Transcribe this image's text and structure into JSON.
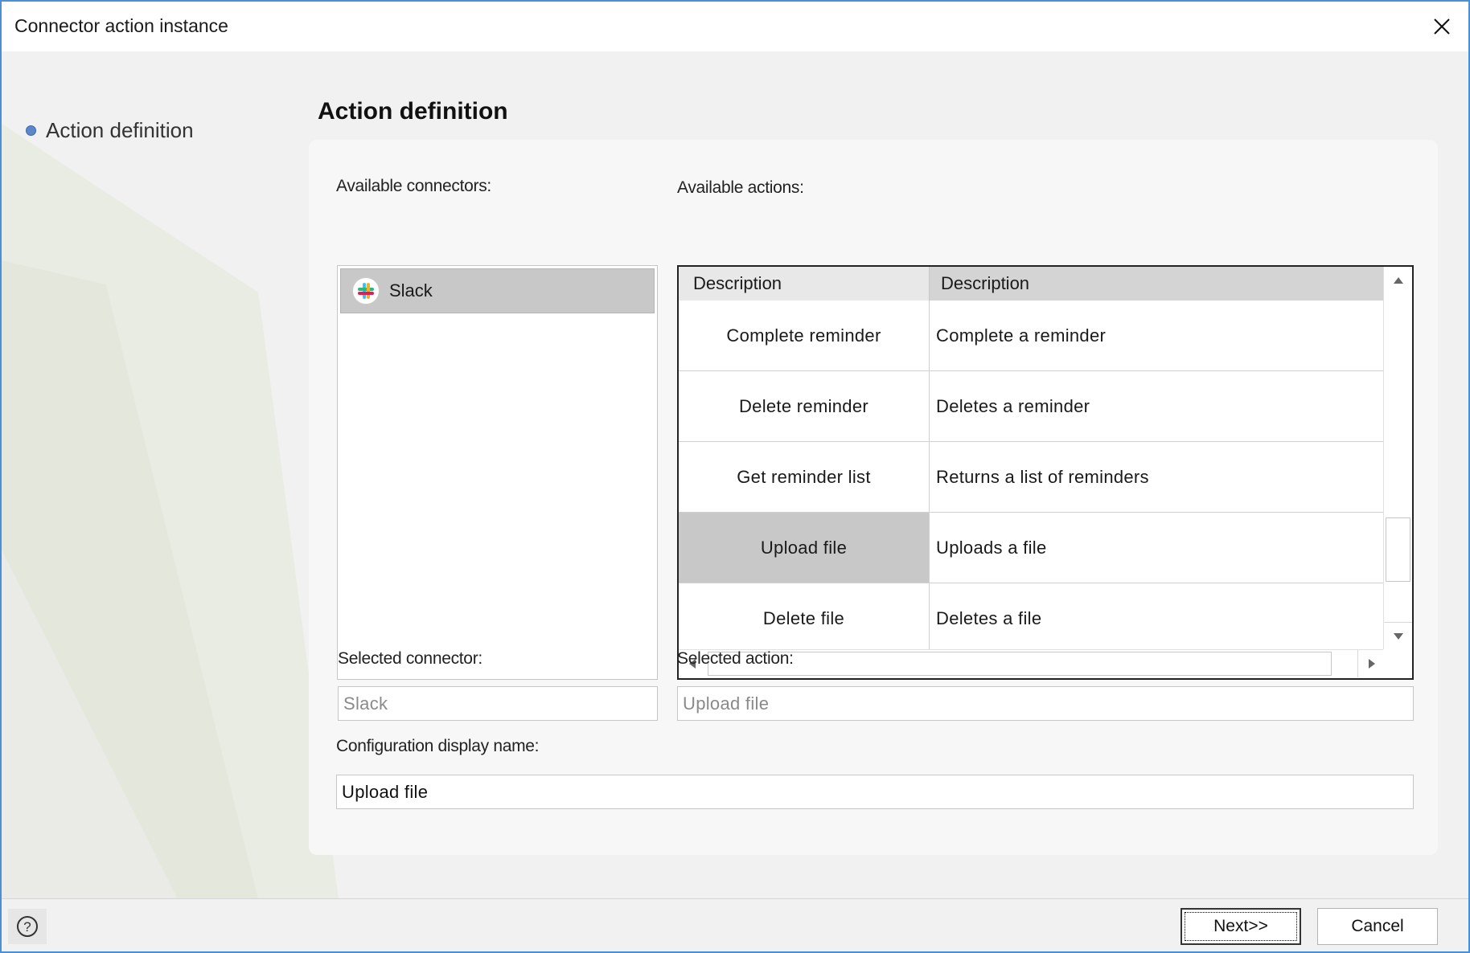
{
  "window": {
    "title": "Connector action instance",
    "close_icon": "close-icon"
  },
  "wizard": {
    "steps": [
      {
        "label": "Action definition",
        "active": true
      }
    ],
    "section_title": "Action definition"
  },
  "connectors": {
    "label": "Available connectors:",
    "items": [
      {
        "label": "Slack",
        "icon": "slack-icon",
        "selected": true
      }
    ]
  },
  "actions": {
    "label": "Available actions:",
    "columns": [
      "Description",
      "Description"
    ],
    "rows": [
      {
        "name": "Complete reminder",
        "description": "Complete a reminder",
        "selected": false
      },
      {
        "name": "Delete reminder",
        "description": "Deletes a reminder",
        "selected": false
      },
      {
        "name": "Get reminder list",
        "description": "Returns a list of reminders",
        "selected": false
      },
      {
        "name": "Upload file",
        "description": "Uploads a file",
        "selected": true
      },
      {
        "name": "Delete file",
        "description": "Deletes a file",
        "selected": false
      }
    ]
  },
  "selected_connector": {
    "label": "Selected connector:",
    "value": "Slack"
  },
  "selected_action": {
    "label": "Selected action:",
    "value": "Upload file"
  },
  "display_name": {
    "label": "Configuration display name:",
    "value": "Upload file"
  },
  "footer": {
    "help_icon": "help-icon",
    "next_label": "Next>>",
    "cancel_label": "Cancel"
  },
  "colors": {
    "window_border": "#4a90d9",
    "selected_row": "#c8c8c8",
    "step_bullet": "#5b86c8"
  }
}
